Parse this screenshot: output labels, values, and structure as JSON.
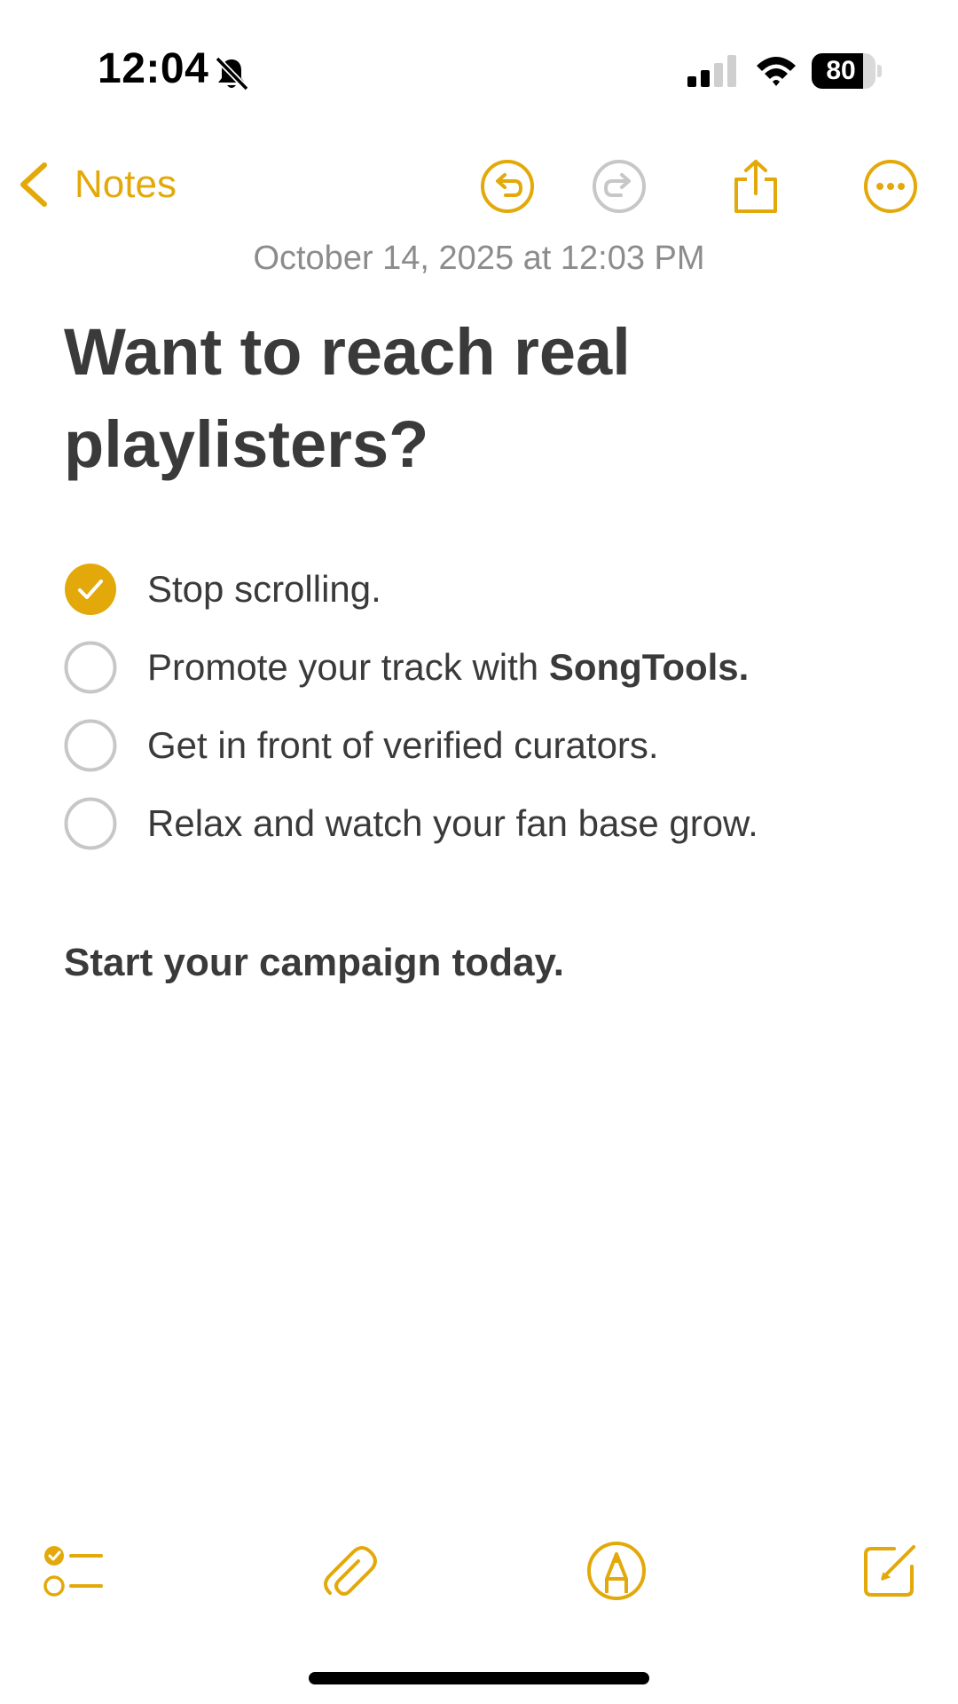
{
  "status_bar": {
    "time": "12:04",
    "battery_level": "80",
    "battery_fraction": 0.8,
    "signal_bars_active": 2,
    "signal_bars_total": 4
  },
  "nav": {
    "back_label": "Notes",
    "icons": [
      "chevron-left-icon",
      "undo-icon",
      "redo-icon",
      "share-icon",
      "more-icon"
    ]
  },
  "note": {
    "date": "October 14, 2025 at 12:03 PM",
    "title": "Want to reach real playlisters?",
    "checklist": [
      {
        "text": "Stop scrolling.",
        "checked": true
      },
      {
        "text_before": "Promote your track with ",
        "text_bold": "SongTools.",
        "checked": false
      },
      {
        "text": "Get in front of verified curators.",
        "checked": false
      },
      {
        "text": "Relax and watch your fan base grow.",
        "checked": false
      }
    ],
    "footer": "Start your campaign today."
  },
  "toolbar": {
    "icons": [
      "checklist-icon",
      "paperclip-icon",
      "markup-pen-icon",
      "compose-icon"
    ]
  },
  "colors": {
    "accent": "#e3a90a",
    "text": "#3a3a3a",
    "secondary_text": "#8c8c8c",
    "disabled": "#c7c7c7"
  }
}
